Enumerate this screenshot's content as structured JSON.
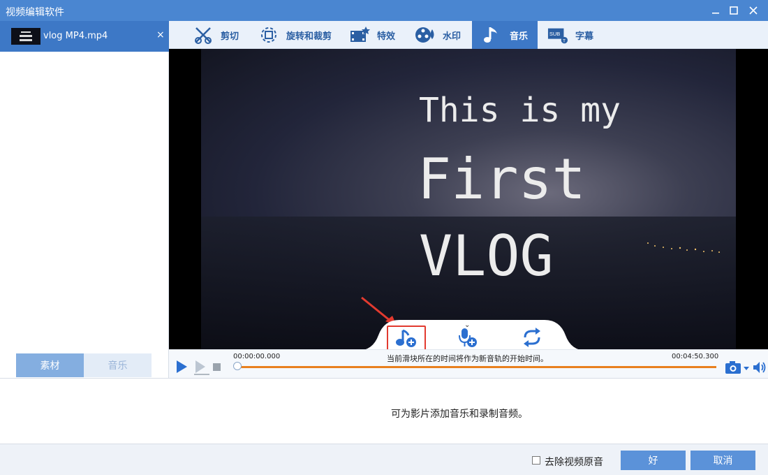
{
  "window": {
    "title": "视频编辑软件",
    "min_icon": "minimize-icon",
    "max_icon": "maximize-icon",
    "close_icon": "close-icon"
  },
  "sidebar": {
    "file": {
      "name": "vlog MP4.mp4",
      "close": "×"
    },
    "tabs": [
      {
        "label": "素材",
        "active": true
      },
      {
        "label": "音乐",
        "active": false
      }
    ]
  },
  "toolbar": {
    "tabs": [
      {
        "label": "剪切",
        "icon": "cut-icon"
      },
      {
        "label": "旋转和裁剪",
        "icon": "rotate-crop-icon"
      },
      {
        "label": "特效",
        "icon": "effects-icon"
      },
      {
        "label": "水印",
        "icon": "watermark-icon"
      },
      {
        "label": "音乐",
        "icon": "music-icon",
        "active": true
      },
      {
        "label": "字幕",
        "icon": "subtitle-icon"
      }
    ]
  },
  "video": {
    "line1": "This is my",
    "line2": "First",
    "line3": "VLOG"
  },
  "music_tools": {
    "add_music": "add-music-icon",
    "record": "record-audio-icon",
    "loop": "loop-icon"
  },
  "timeline": {
    "start_time": "00:00:00.000",
    "end_time": "00:04:50.300",
    "hint": "当前滑块所在的时间将作为新音轨的开始时间。",
    "progress": 0
  },
  "info": {
    "text": "可为影片添加音乐和录制音频。"
  },
  "bottom": {
    "checkbox_label": "去除视频原音",
    "checkbox_checked": false,
    "ok_label": "好",
    "cancel_label": "取消"
  },
  "colors": {
    "accent": "#3d78c6",
    "titlebar": "#4a86d1",
    "track": "#e8801e",
    "highlight": "#e23a2f"
  }
}
